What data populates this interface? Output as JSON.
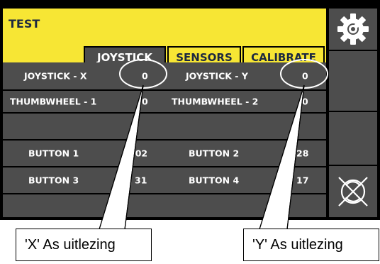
{
  "app": {
    "title": "TEST"
  },
  "tabs": [
    {
      "label": "JOYSTICK",
      "active": true
    },
    {
      "label": "SENSORS",
      "active": false
    },
    {
      "label": "CALIBRATE",
      "active": false
    }
  ],
  "rows": {
    "joystick_x": {
      "label": "JOYSTICK - X",
      "value": "0"
    },
    "joystick_y": {
      "label": "JOYSTICK - Y",
      "value": "0"
    },
    "thumbwheel_1": {
      "label": "THUMBWHEEL - 1",
      "value": "0"
    },
    "thumbwheel_2": {
      "label": "THUMBWHEEL - 2",
      "value": "0"
    },
    "button_1": {
      "label": "BUTTON 1",
      "value": "102"
    },
    "button_2": {
      "label": "BUTTON 2",
      "value": "28"
    },
    "button_3": {
      "label": "BUTTON 3",
      "value": "31"
    },
    "button_4": {
      "label": "BUTTON 4",
      "value": "17"
    }
  },
  "side": {
    "settings_icon": "gear-wrench-icon",
    "reset_icon": "crossed-circle-arrows-icon"
  },
  "callouts": {
    "x": "'X' As uitlezing",
    "y": "'Y' As uitlezing"
  },
  "colors": {
    "header": "#f7e634",
    "panel": "#4d4d4d",
    "text_dark": "#1c2840"
  }
}
